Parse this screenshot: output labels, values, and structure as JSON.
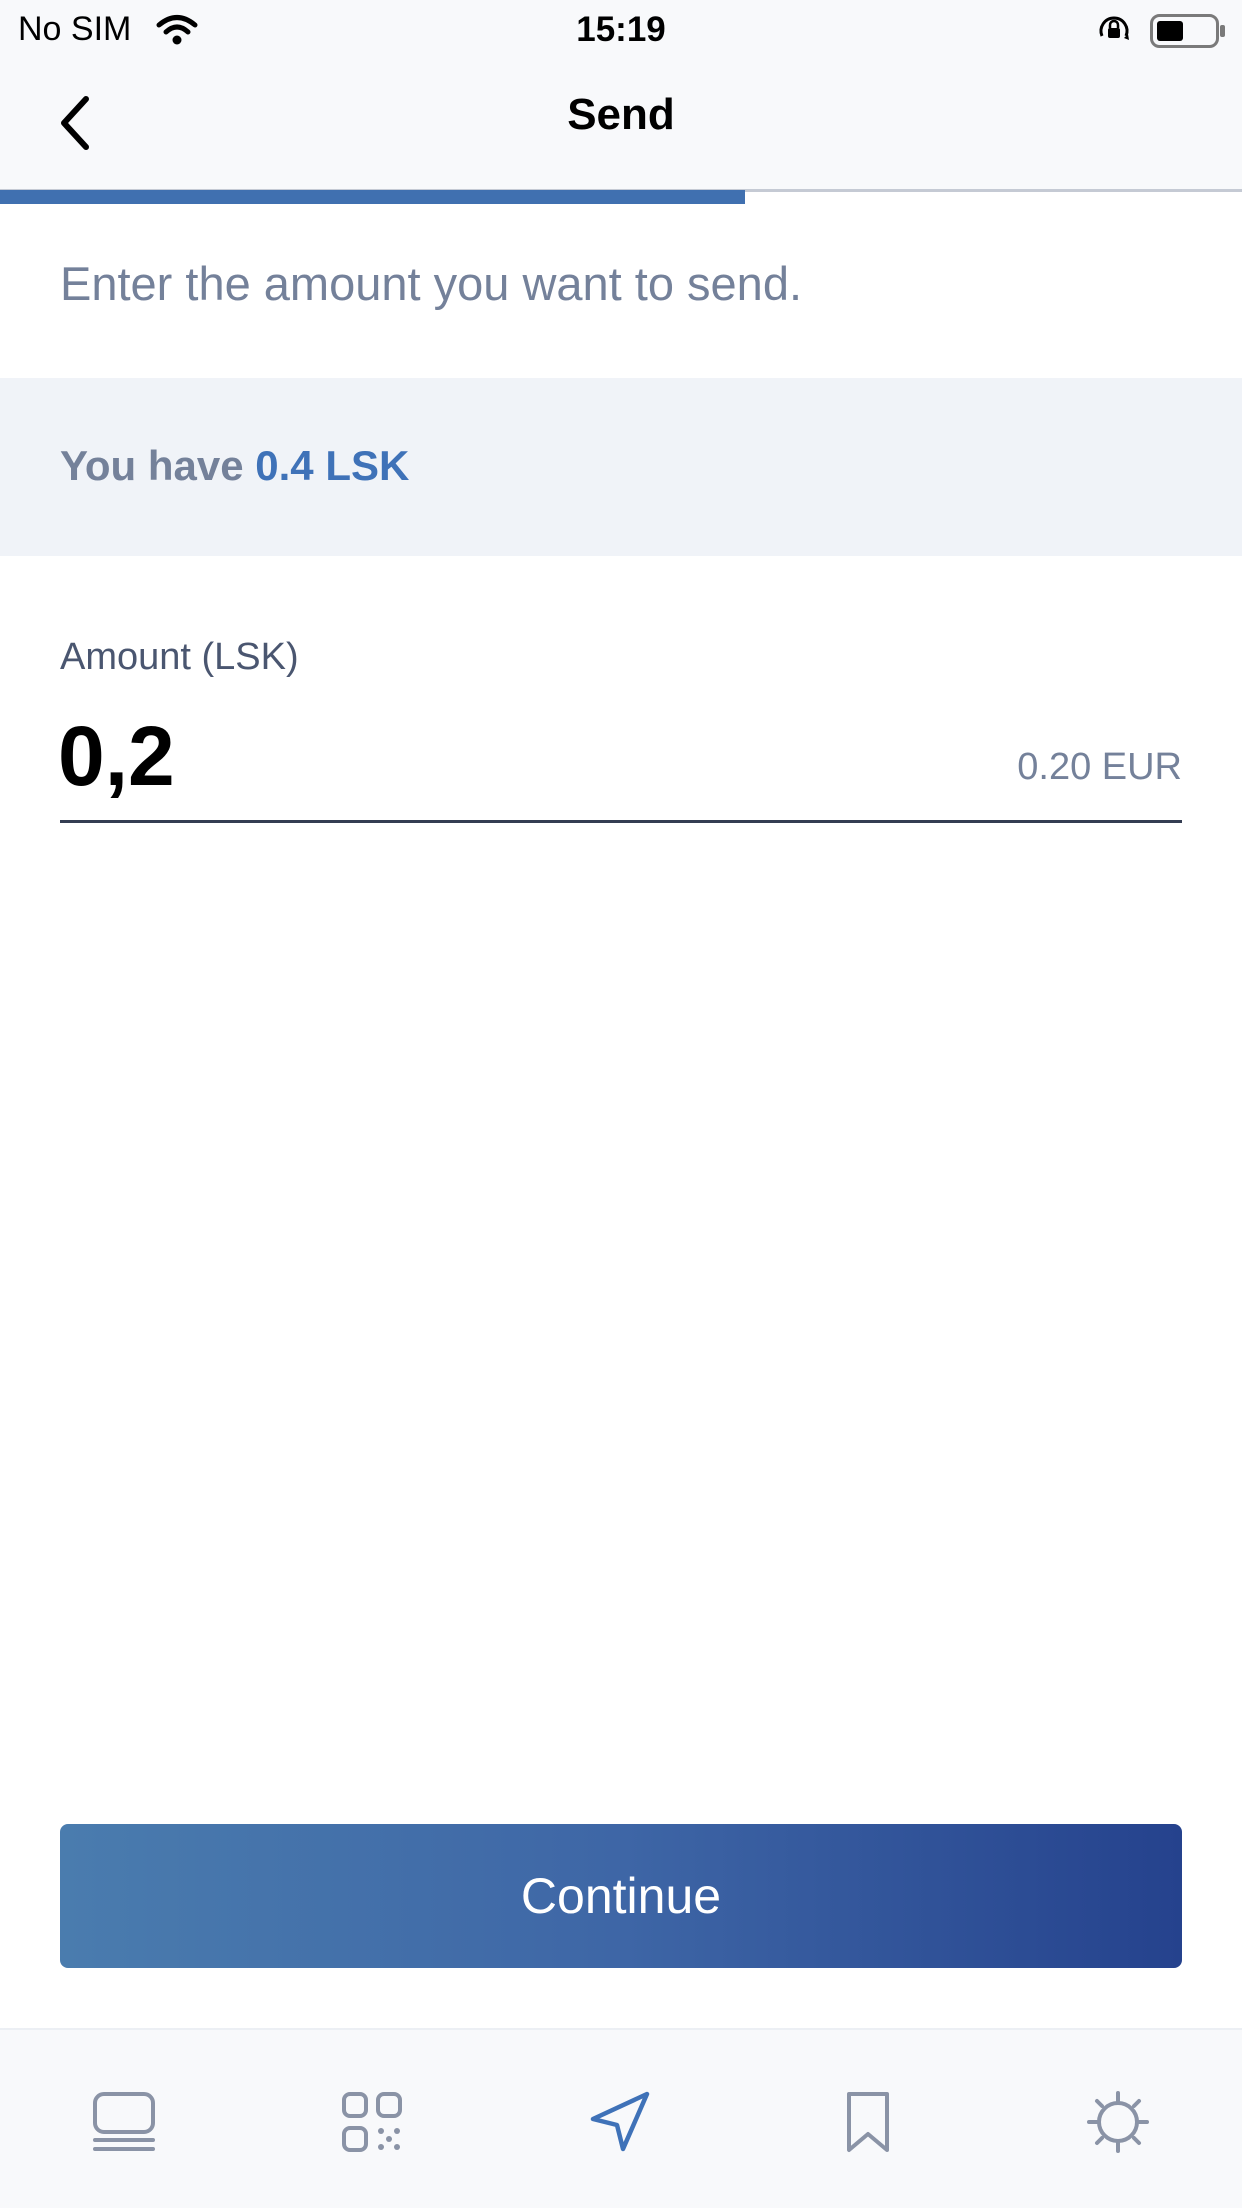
{
  "status_bar": {
    "carrier": "No SIM",
    "time": "15:19",
    "icons": [
      "wifi-icon",
      "orientation-lock-icon",
      "battery-icon"
    ]
  },
  "navbar": {
    "title": "Send",
    "back_icon": "chevron-left-icon"
  },
  "progress": {
    "fraction": 0.6
  },
  "instruction": "Enter the amount you want to send.",
  "balance": {
    "prefix": "You have ",
    "value": "0.4 LSK"
  },
  "amount": {
    "label": "Amount (LSK)",
    "value": "0,2",
    "fiat": "0.20 EUR"
  },
  "continue_label": "Continue",
  "tab_bar": {
    "items": [
      {
        "name": "home",
        "icon": "wallet-icon"
      },
      {
        "name": "request",
        "icon": "qr-code-icon"
      },
      {
        "name": "send",
        "icon": "send-icon",
        "active": true
      },
      {
        "name": "bookmarks",
        "icon": "bookmark-icon"
      },
      {
        "name": "settings",
        "icon": "settings-icon"
      }
    ]
  },
  "colors": {
    "accent": "#3f72b8",
    "button_gradient_start": "#4a7cae",
    "button_gradient_end": "#25428d",
    "muted_text": "#74819a",
    "band_background": "#f0f3f8"
  }
}
